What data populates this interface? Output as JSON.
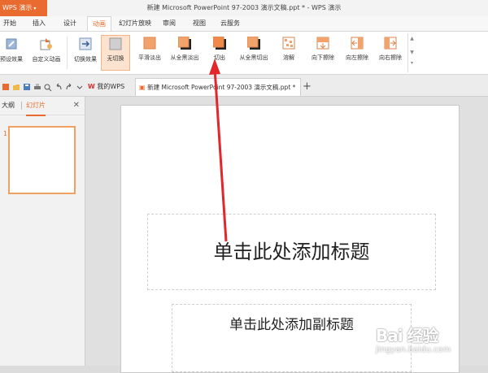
{
  "app": {
    "name": "WPS 演示",
    "window_title": "新建 Microsoft PowerPoint 97-2003 演示文稿.ppt * - WPS 演示"
  },
  "menu": {
    "tabs": [
      "开始",
      "插入",
      "设计",
      "动画",
      "幻灯片放映",
      "审阅",
      "视图",
      "云服务"
    ],
    "active": "动画"
  },
  "ribbon": {
    "custom_anim_label": "自定义动画",
    "preset_anim_label": "预设效果",
    "transition_effect_label": "切换效果",
    "transitions": [
      "无切换",
      "平滑淡出",
      "从全黑淡出",
      "切出",
      "从全黑切出",
      "溶解",
      "向下擦除",
      "向左擦除",
      "向右擦除"
    ]
  },
  "doc_tabs": {
    "home": "我的WPS",
    "current": "新建 Microsoft PowerPoint 97-2003 演示文稿.ppt *"
  },
  "left_panel": {
    "outline_tab": "大纲",
    "slides_tab": "幻灯片",
    "slide_number": "1"
  },
  "slide": {
    "title_placeholder": "单击此处添加标题",
    "subtitle_placeholder": "单击此处添加副标题"
  },
  "watermark": {
    "main": "Bai 经验",
    "sub": "jingyan.baidu.com"
  },
  "colors": {
    "accent": "#e96b2f",
    "arrow": "#e3262b"
  }
}
